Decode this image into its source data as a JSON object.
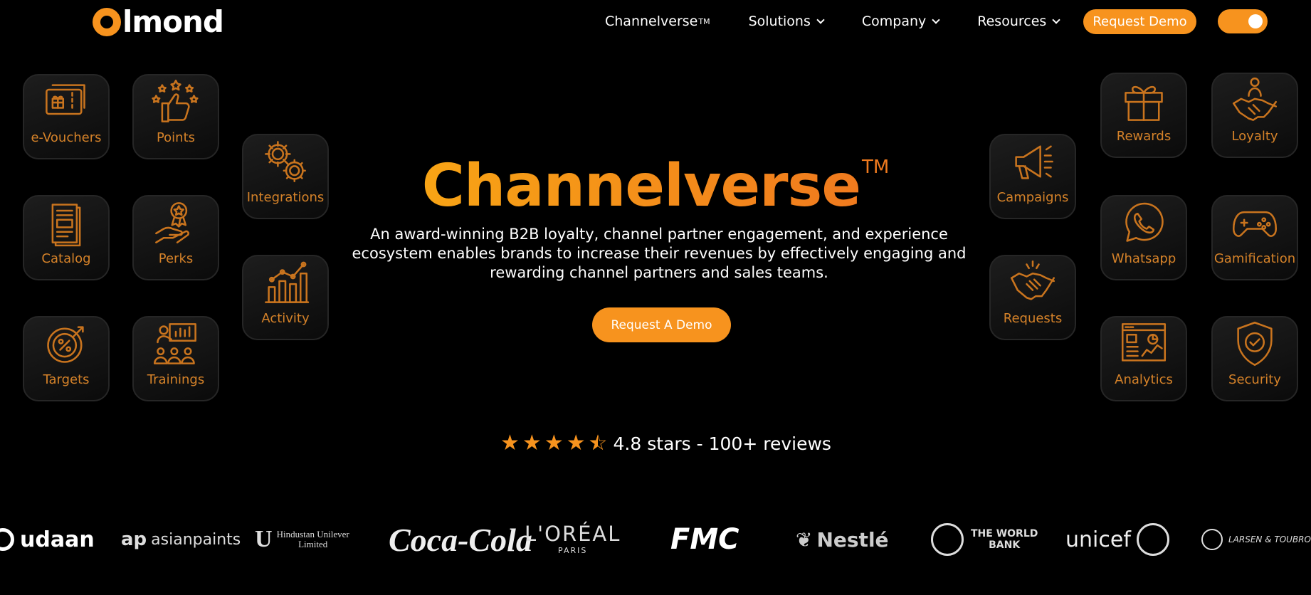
{
  "brand": {
    "logo_text": "lmond",
    "accent": "#f7931e"
  },
  "nav": {
    "items": [
      {
        "label": "Channelverse",
        "sup": "TM"
      },
      {
        "label": "Solutions"
      },
      {
        "label": "Company"
      },
      {
        "label": "Resources"
      }
    ],
    "demo_label": "Request Demo"
  },
  "cards": {
    "evouchers": "e-Vouchers",
    "points": "Points",
    "catalog": "Catalog",
    "perks": "Perks",
    "targets": "Targets",
    "trainings": "Trainings",
    "integrations": "Integrations",
    "activity": "Activity",
    "campaigns": "Campaigns",
    "requests": "Requests",
    "rewards": "Rewards",
    "loyalty": "Loyalty",
    "whatsapp": "Whatsapp",
    "gamification": "Gamification",
    "analytics": "Analytics",
    "security": "Security"
  },
  "hero": {
    "title": "Channelverse",
    "title_mark": "TM",
    "description": "An award-winning B2B loyalty, channel partner engagement, and experience ecosystem enables brands to increase their revenues by effectively engaging and rewarding channel partners and sales teams.",
    "cta": "Request A Demo"
  },
  "rating": {
    "value": 4.5,
    "max": 5,
    "text": "4.8 stars - 100+ reviews"
  },
  "logos": {
    "udaan": "udaan",
    "asianpaints": "asianpaints",
    "asian_mark": "ap",
    "hul_line1": "Hindustan Unilever",
    "hul_line2": "Limited",
    "hul_mark": "U",
    "cocacola": "Coca-Cola",
    "loreal": "L'ORÉAL",
    "loreal_sub": "PARIS",
    "fmc": "FMC",
    "nestle": "Nestlé",
    "worldbank_1": "THE WORLD",
    "worldbank_2": "BANK",
    "unicef": "unicef",
    "lt": "LARSEN & TOUBRO"
  }
}
